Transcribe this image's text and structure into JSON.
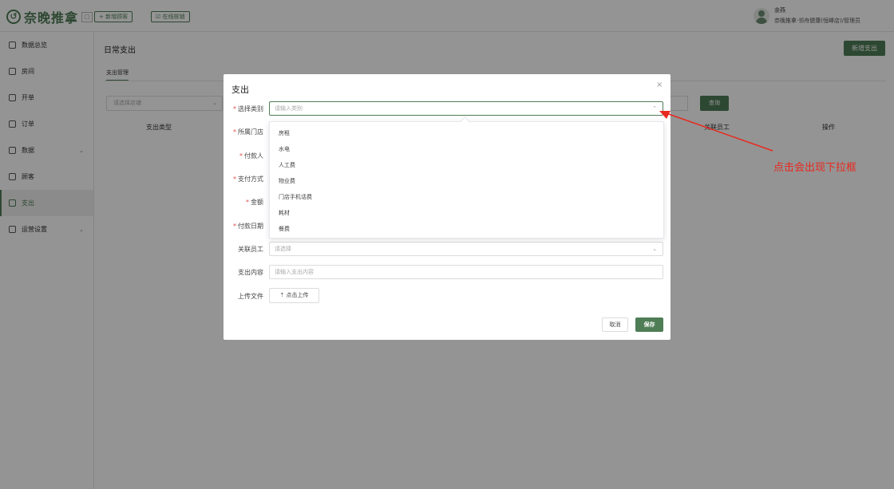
{
  "header": {
    "logo_mark": "↺",
    "logo_text": "奈晚推拿",
    "logo_box": "□",
    "btn_new_customer": "+ 新增顾客",
    "btn_online_verify": "☑ 在线核销",
    "user_name": "余燕",
    "user_org": "奈晚推拿·邻舟健康(恒峰店)/管理员"
  },
  "sidebar": {
    "items": [
      {
        "label": "数据总览",
        "icon": "monitor-icon",
        "chevron": ""
      },
      {
        "label": "房间",
        "icon": "home-icon",
        "chevron": ""
      },
      {
        "label": "开单",
        "icon": "document-icon",
        "chevron": ""
      },
      {
        "label": "订单",
        "icon": "list-icon",
        "chevron": ""
      },
      {
        "label": "数据",
        "icon": "chart-icon",
        "chevron": "⌄"
      },
      {
        "label": "顾客",
        "icon": "user-icon",
        "chevron": ""
      },
      {
        "label": "支出",
        "icon": "wallet-icon",
        "chevron": ""
      },
      {
        "label": "运营设置",
        "icon": "settings-icon",
        "chevron": "⌄"
      }
    ],
    "active_index": 6
  },
  "main": {
    "title": "日常支出",
    "add_button": "新增支出",
    "tab": "支出管理",
    "store_placeholder": "请选择店铺",
    "query_button": "查询",
    "columns": [
      "支出类型",
      "关联员工",
      "操作"
    ]
  },
  "modal": {
    "title": "支出",
    "close": "×",
    "fields": {
      "category": {
        "label": "选择类别",
        "required": true,
        "placeholder": "请输入类别"
      },
      "store": {
        "label": "所属门店",
        "required": true
      },
      "payer": {
        "label": "付款人",
        "required": true
      },
      "pay_method": {
        "label": "支付方式",
        "required": true
      },
      "amount": {
        "label": "金额",
        "required": true
      },
      "pay_date": {
        "label": "付款日期",
        "required": true
      },
      "employee": {
        "label": "关联员工",
        "required": false,
        "placeholder": "请选择"
      },
      "content": {
        "label": "支出内容",
        "required": false,
        "placeholder": "请输入支出内容"
      },
      "upload": {
        "label": "上传文件",
        "required": false,
        "button": "⇡ 点击上传"
      }
    },
    "cancel_button": "取消",
    "save_button": "保存",
    "required_mark": "*"
  },
  "dropdown": {
    "options": [
      "房租",
      "水电",
      "人工费",
      "物业费",
      "门店手机话费",
      "耗材",
      "餐费"
    ]
  },
  "annotation": {
    "text": "点击会出现下拉框",
    "color": "#e8291f"
  },
  "colors": {
    "accent": "#4f7d56",
    "required": "#e34d4d"
  }
}
